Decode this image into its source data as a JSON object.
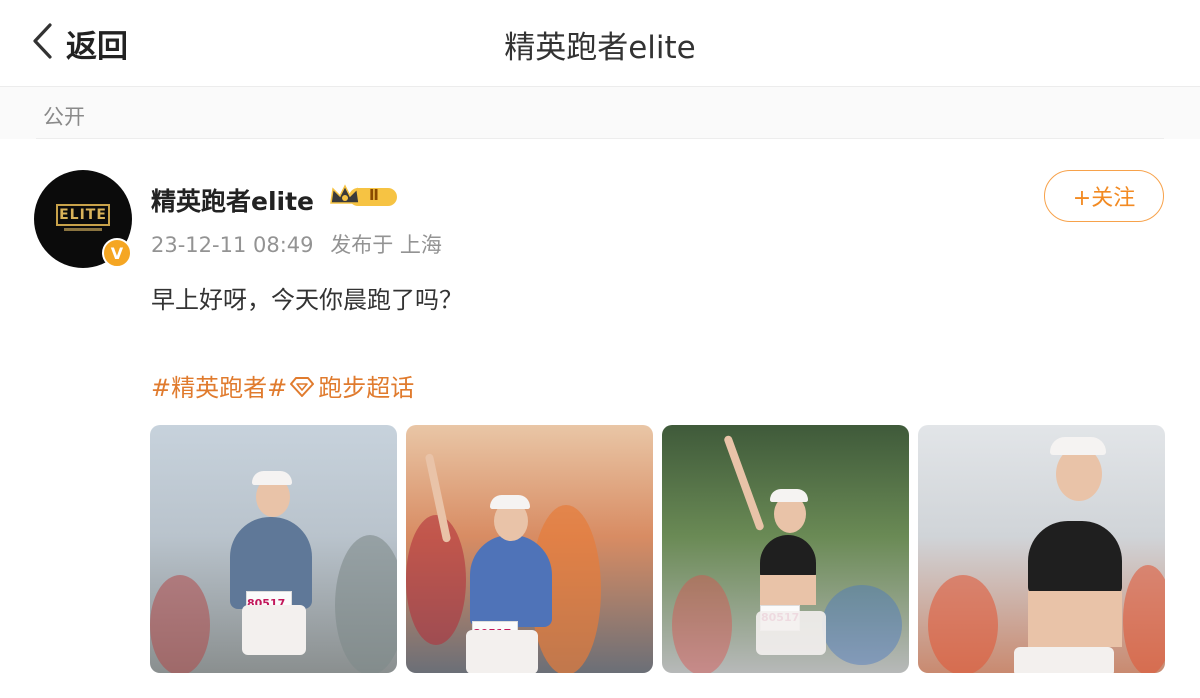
{
  "header": {
    "back_label": "返回",
    "title": "精英跑者elite"
  },
  "visibility": {
    "label": "公开"
  },
  "post": {
    "author": {
      "name": "精英跑者elite",
      "avatar_text": "ELITE",
      "verified_badge": "V",
      "level_badge": "Ⅱ"
    },
    "time": "23-12-11 08:49",
    "source": "发布于 上海",
    "follow_label": "+关注",
    "text": "早上好呀，今天你晨跑了吗？",
    "topics": {
      "tag": "#精英跑者#",
      "super_topic": "跑步超话"
    },
    "photos": [
      {
        "bib": "80517"
      },
      {
        "bib": "80517"
      },
      {
        "bib": "80517"
      },
      {
        "bib": ""
      }
    ]
  },
  "colors": {
    "accent": "#e07b2e",
    "follow_border": "#f7a24b",
    "verified": "#f5a623"
  },
  "icons": {
    "back": "chevron-left-icon",
    "super_topic": "diamond-icon",
    "level": "crown-icon"
  }
}
